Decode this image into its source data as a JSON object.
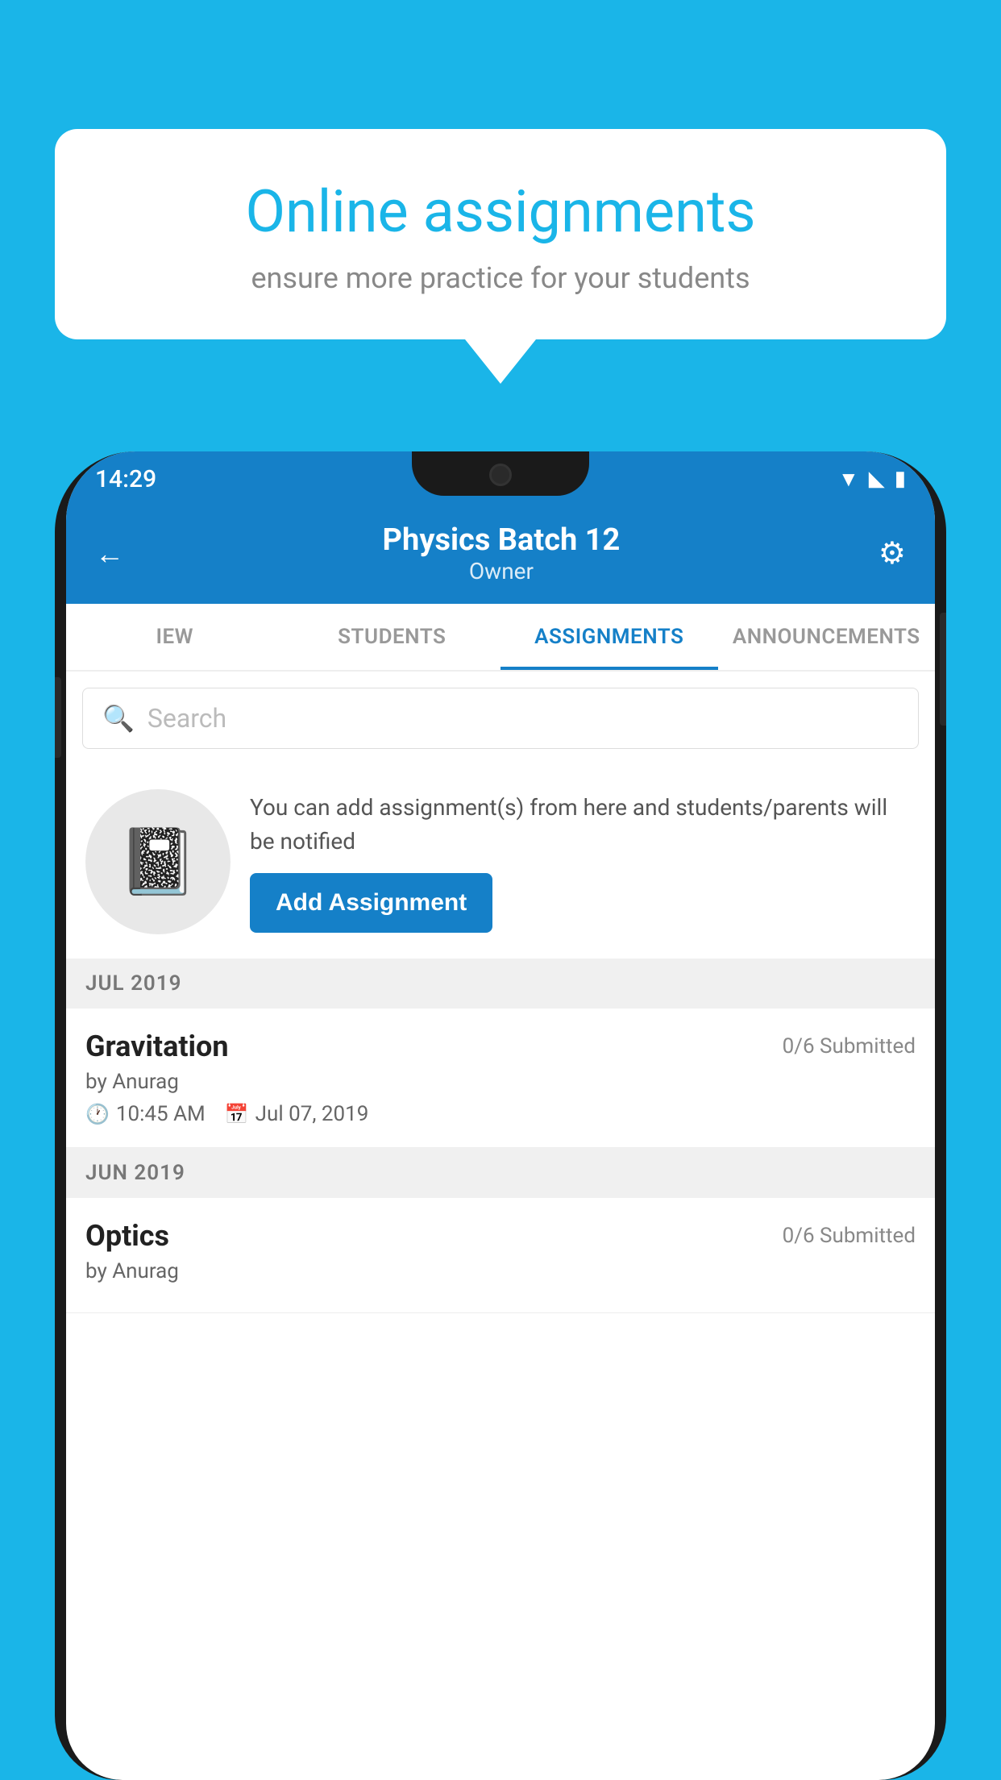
{
  "background": {
    "color": "#1ab5e8"
  },
  "speech_bubble": {
    "title": "Online assignments",
    "subtitle": "ensure more practice for your students"
  },
  "status_bar": {
    "time": "14:29",
    "icons": [
      "wifi",
      "signal",
      "battery"
    ]
  },
  "header": {
    "title": "Physics Batch 12",
    "subtitle": "Owner",
    "back_label": "←",
    "settings_label": "⚙"
  },
  "tabs": [
    {
      "label": "IEW",
      "active": false
    },
    {
      "label": "STUDENTS",
      "active": false
    },
    {
      "label": "ASSIGNMENTS",
      "active": true
    },
    {
      "label": "ANNOUNCEMENTS",
      "active": false
    }
  ],
  "search": {
    "placeholder": "Search"
  },
  "promo": {
    "text": "You can add assignment(s) from here and students/parents will be notified",
    "button_label": "Add Assignment"
  },
  "months": [
    {
      "label": "JUL 2019",
      "assignments": [
        {
          "title": "Gravitation",
          "submitted": "0/6 Submitted",
          "author": "by Anurag",
          "time": "10:45 AM",
          "date": "Jul 07, 2019"
        }
      ]
    },
    {
      "label": "JUN 2019",
      "assignments": [
        {
          "title": "Optics",
          "submitted": "0/6 Submitted",
          "author": "by Anurag",
          "time": "",
          "date": ""
        }
      ]
    }
  ]
}
